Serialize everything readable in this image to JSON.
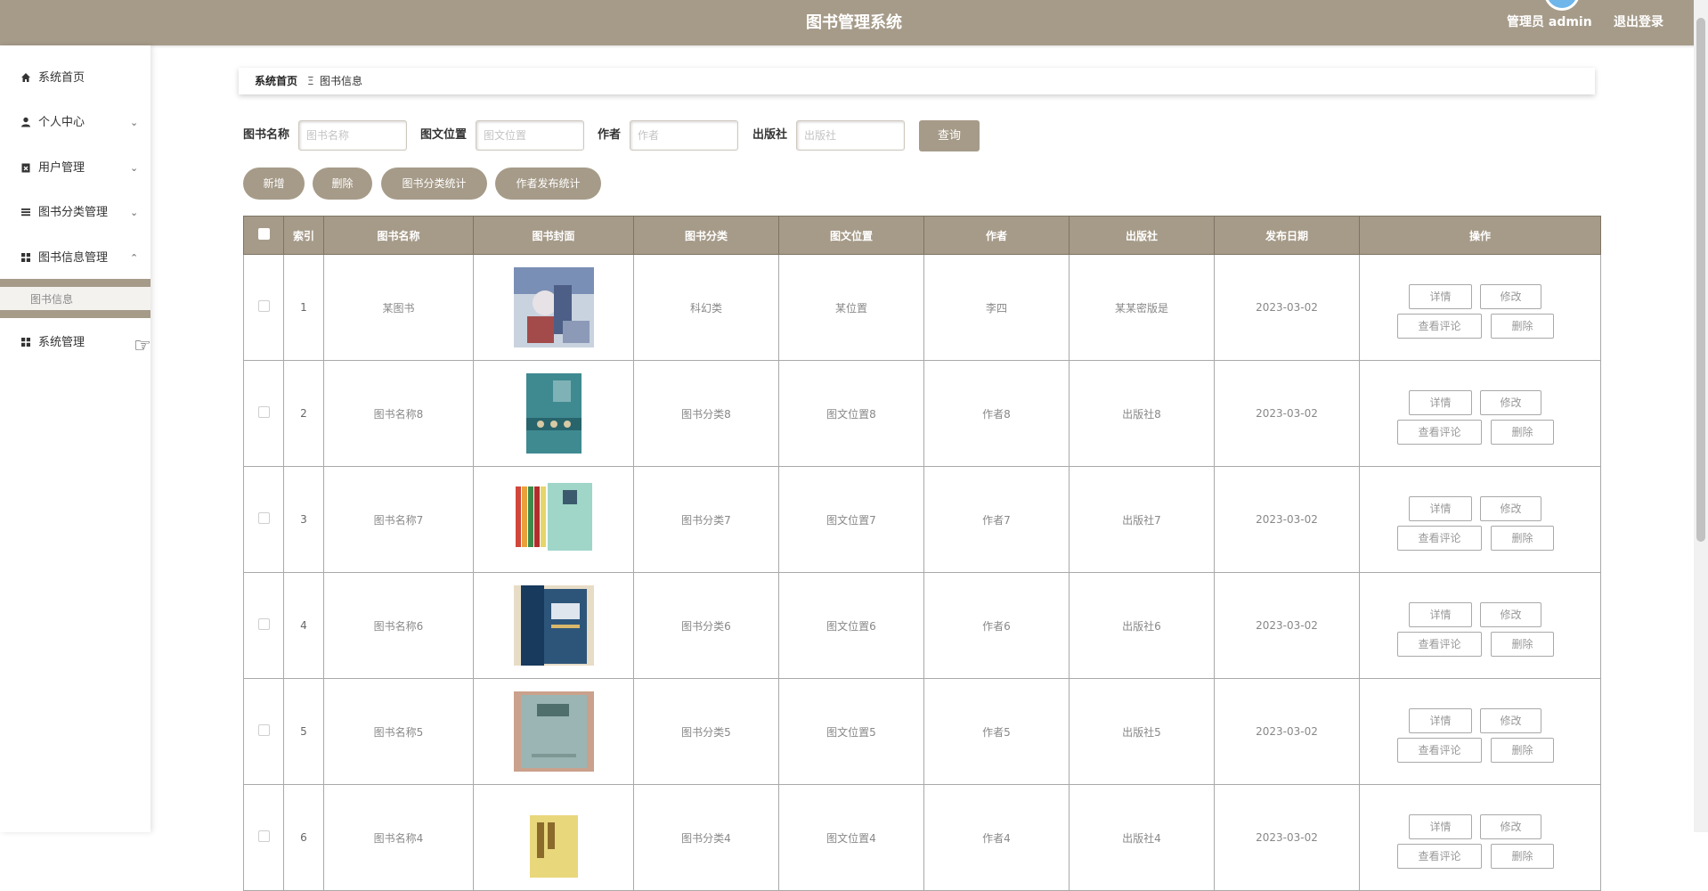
{
  "header": {
    "title": "图书管理系统",
    "admin_label": "管理员 admin",
    "logout_label": "退出登录"
  },
  "sidebar": {
    "items": [
      {
        "label": "系统首页",
        "icon": "home-icon"
      },
      {
        "label": "个人中心",
        "icon": "user-icon"
      },
      {
        "label": "用户管理",
        "icon": "clipboard-icon"
      },
      {
        "label": "图书分类管理",
        "icon": "list-icon"
      },
      {
        "label": "图书信息管理",
        "icon": "grid-icon"
      },
      {
        "label": "系统管理",
        "icon": "grid-icon"
      }
    ],
    "sub_item": "图书信息"
  },
  "breadcrumb": {
    "home": "系统首页",
    "separator": "Ξ",
    "current": "图书信息"
  },
  "search": {
    "book_name_label": "图书名称",
    "book_name_placeholder": "图书名称",
    "location_label": "图文位置",
    "location_placeholder": "图文位置",
    "author_label": "作者",
    "author_placeholder": "作者",
    "publisher_label": "出版社",
    "publisher_placeholder": "出版社",
    "query_label": "查询"
  },
  "actions": {
    "add": "新增",
    "delete": "删除",
    "category_stats": "图书分类统计",
    "author_stats": "作者发布统计"
  },
  "table": {
    "headers": [
      "索引",
      "图书名称",
      "图书封面",
      "图书分类",
      "图文位置",
      "作者",
      "出版社",
      "发布日期",
      "操作"
    ],
    "row_buttons": {
      "detail": "详情",
      "edit": "修改",
      "comments": "查看评论",
      "delete": "删除"
    },
    "rows": [
      {
        "index": "1",
        "name": "某图书",
        "category": "科幻类",
        "location": "某位置",
        "author": "李四",
        "publisher": "某某密版是",
        "date": "2023-03-02"
      },
      {
        "index": "2",
        "name": "图书名称8",
        "category": "图书分类8",
        "location": "图文位置8",
        "author": "作者8",
        "publisher": "出版社8",
        "date": "2023-03-02"
      },
      {
        "index": "3",
        "name": "图书名称7",
        "category": "图书分类7",
        "location": "图文位置7",
        "author": "作者7",
        "publisher": "出版社7",
        "date": "2023-03-02"
      },
      {
        "index": "4",
        "name": "图书名称6",
        "category": "图书分类6",
        "location": "图文位置6",
        "author": "作者6",
        "publisher": "出版社6",
        "date": "2023-03-02"
      },
      {
        "index": "5",
        "name": "图书名称5",
        "category": "图书分类5",
        "location": "图文位置5",
        "author": "作者5",
        "publisher": "出版社5",
        "date": "2023-03-02"
      },
      {
        "index": "6",
        "name": "图书名称4",
        "category": "图书分类4",
        "location": "图文位置4",
        "author": "作者4",
        "publisher": "出版社4",
        "date": "2023-03-02"
      }
    ]
  },
  "colors": {
    "accent": "#a69b89",
    "header_border": "#7e7464"
  }
}
